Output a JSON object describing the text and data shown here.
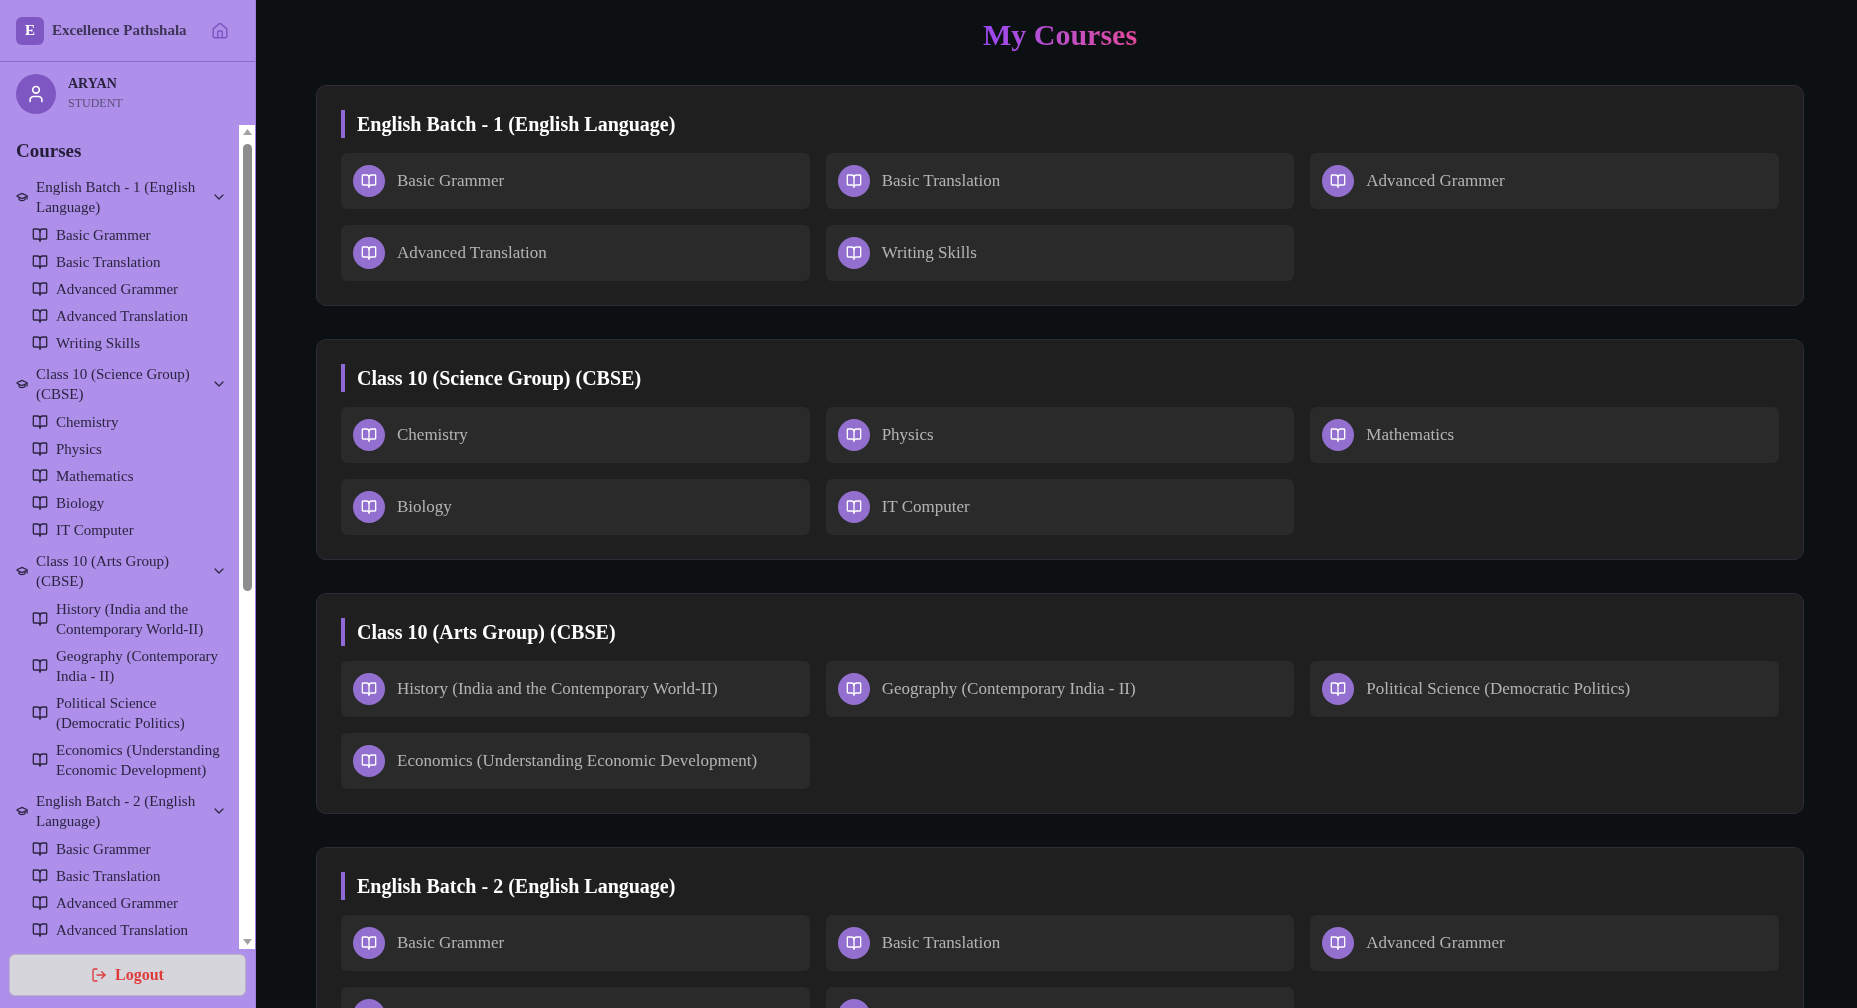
{
  "sidebar": {
    "brand": {
      "logo_letter": "E",
      "name": "Excellence Pathshala"
    },
    "user": {
      "name": "ARYAN",
      "role": "STUDENT"
    },
    "section_title": "Courses",
    "groups": [
      {
        "title": "English Batch - 1 (English Language)",
        "expanded": true,
        "children": [
          {
            "label": "Basic Grammer"
          },
          {
            "label": "Basic Translation"
          },
          {
            "label": "Advanced Grammer"
          },
          {
            "label": "Advanced Translation"
          },
          {
            "label": "Writing Skills"
          }
        ]
      },
      {
        "title": "Class 10 (Science Group) (CBSE)",
        "expanded": true,
        "children": [
          {
            "label": "Chemistry"
          },
          {
            "label": "Physics"
          },
          {
            "label": "Mathematics"
          },
          {
            "label": "Biology"
          },
          {
            "label": "IT Computer"
          }
        ]
      },
      {
        "title": "Class 10 (Arts Group) (CBSE)",
        "expanded": true,
        "children": [
          {
            "label": "History (India and the Contemporary World-II)"
          },
          {
            "label": "Geography (Contemporary India - II)"
          },
          {
            "label": "Political Science (Democratic Politics)"
          },
          {
            "label": "Economics (Understanding Economic Development)"
          }
        ]
      },
      {
        "title": "English Batch - 2 (English Language)",
        "expanded": true,
        "children": [
          {
            "label": "Basic Grammer"
          },
          {
            "label": "Basic Translation"
          },
          {
            "label": "Advanced Grammer"
          },
          {
            "label": "Advanced Translation"
          }
        ]
      }
    ],
    "logout": "Logout"
  },
  "main": {
    "title": "My Courses",
    "batches": [
      {
        "title": "English Batch - 1 (English Language)",
        "courses": [
          {
            "kind": "course",
            "label": "Basic Grammer"
          },
          {
            "kind": "course",
            "label": "Basic Translation"
          },
          {
            "kind": "course",
            "label": "Advanced Grammer"
          },
          {
            "kind": "course",
            "label": "Advanced Translation"
          },
          {
            "kind": "course",
            "label": "Writing Skills"
          }
        ]
      },
      {
        "title": "Class 10 (Science Group) (CBSE)",
        "courses": [
          {
            "kind": "course",
            "label": "Chemistry"
          },
          {
            "kind": "course",
            "label": "Physics"
          },
          {
            "kind": "course",
            "label": "Mathematics"
          },
          {
            "kind": "course",
            "label": "Biology"
          },
          {
            "kind": "course",
            "label": "IT Computer"
          }
        ]
      },
      {
        "title": "Class 10 (Arts Group) (CBSE)",
        "courses": [
          {
            "kind": "course",
            "label": "History (India and the Contemporary World-II)"
          },
          {
            "kind": "course",
            "label": "Geography (Contemporary India - II)"
          },
          {
            "kind": "course",
            "label": "Political Science (Democratic Politics)"
          },
          {
            "kind": "course",
            "label": "Economics (Understanding Economic Development)"
          }
        ]
      },
      {
        "title": "English Batch - 2 (English Language)",
        "courses": [
          {
            "kind": "course",
            "label": "Basic Grammer"
          },
          {
            "kind": "course",
            "label": "Basic Translation"
          },
          {
            "kind": "course",
            "label": "Advanced Grammer"
          },
          {
            "kind": "cut"
          },
          {
            "kind": "cut"
          }
        ]
      }
    ]
  }
}
